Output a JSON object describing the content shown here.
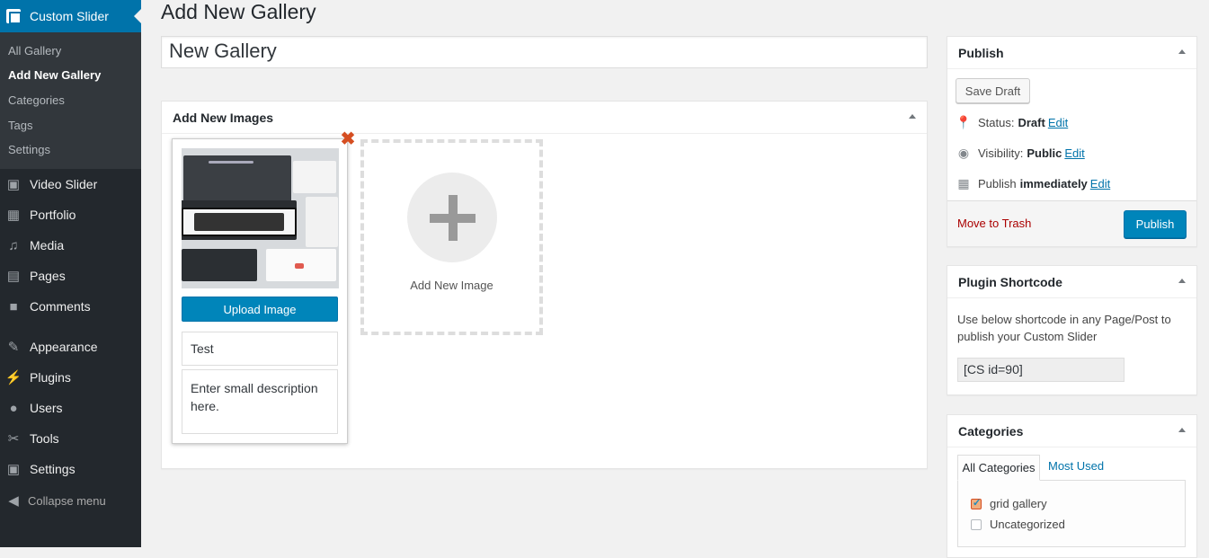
{
  "sidebar": {
    "current": "Custom Slider",
    "submenu": [
      "All Gallery",
      "Add New Gallery",
      "Categories",
      "Tags",
      "Settings"
    ],
    "items": [
      {
        "label": "Video Slider",
        "icon": "video-icon"
      },
      {
        "label": "Portfolio",
        "icon": "grid-icon"
      },
      {
        "label": "Media",
        "icon": "media-icon"
      },
      {
        "label": "Pages",
        "icon": "pages-icon"
      },
      {
        "label": "Comments",
        "icon": "comment-icon"
      },
      {
        "label": "Appearance",
        "icon": "brush-icon"
      },
      {
        "label": "Plugins",
        "icon": "plugin-icon"
      },
      {
        "label": "Users",
        "icon": "user-icon"
      },
      {
        "label": "Tools",
        "icon": "wrench-icon"
      },
      {
        "label": "Settings",
        "icon": "settings-icon"
      }
    ],
    "collapse": "Collapse menu"
  },
  "page": {
    "title": "Add New Gallery",
    "post_title": "New Gallery"
  },
  "images_box": {
    "heading": "Add New Images",
    "upload_label": "Upload Image",
    "image_title": "Test",
    "description_placeholder": "Enter small description here.",
    "add_new_label": "Add New Image"
  },
  "publish": {
    "heading": "Publish",
    "save_draft": "Save Draft",
    "status_label": "Status:",
    "status_value": "Draft",
    "visibility_label": "Visibility:",
    "visibility_value": "Public",
    "publish_label": "Publish",
    "publish_value": "immediately",
    "edit": "Edit",
    "trash": "Move to Trash",
    "publish_button": "Publish"
  },
  "shortcode": {
    "heading": "Plugin Shortcode",
    "text": "Use below shortcode in any Page/Post to publish your Custom Slider",
    "value": "[CS id=90]"
  },
  "categories": {
    "heading": "Categories",
    "tab_all": "All Categories",
    "tab_used": "Most Used",
    "items": [
      {
        "label": "grid gallery",
        "checked": true
      },
      {
        "label": "Uncategorized",
        "checked": false
      }
    ]
  },
  "colors": {
    "accent": "#0073aa",
    "sidebar_bg": "#23282d",
    "trash": "#a00000"
  }
}
